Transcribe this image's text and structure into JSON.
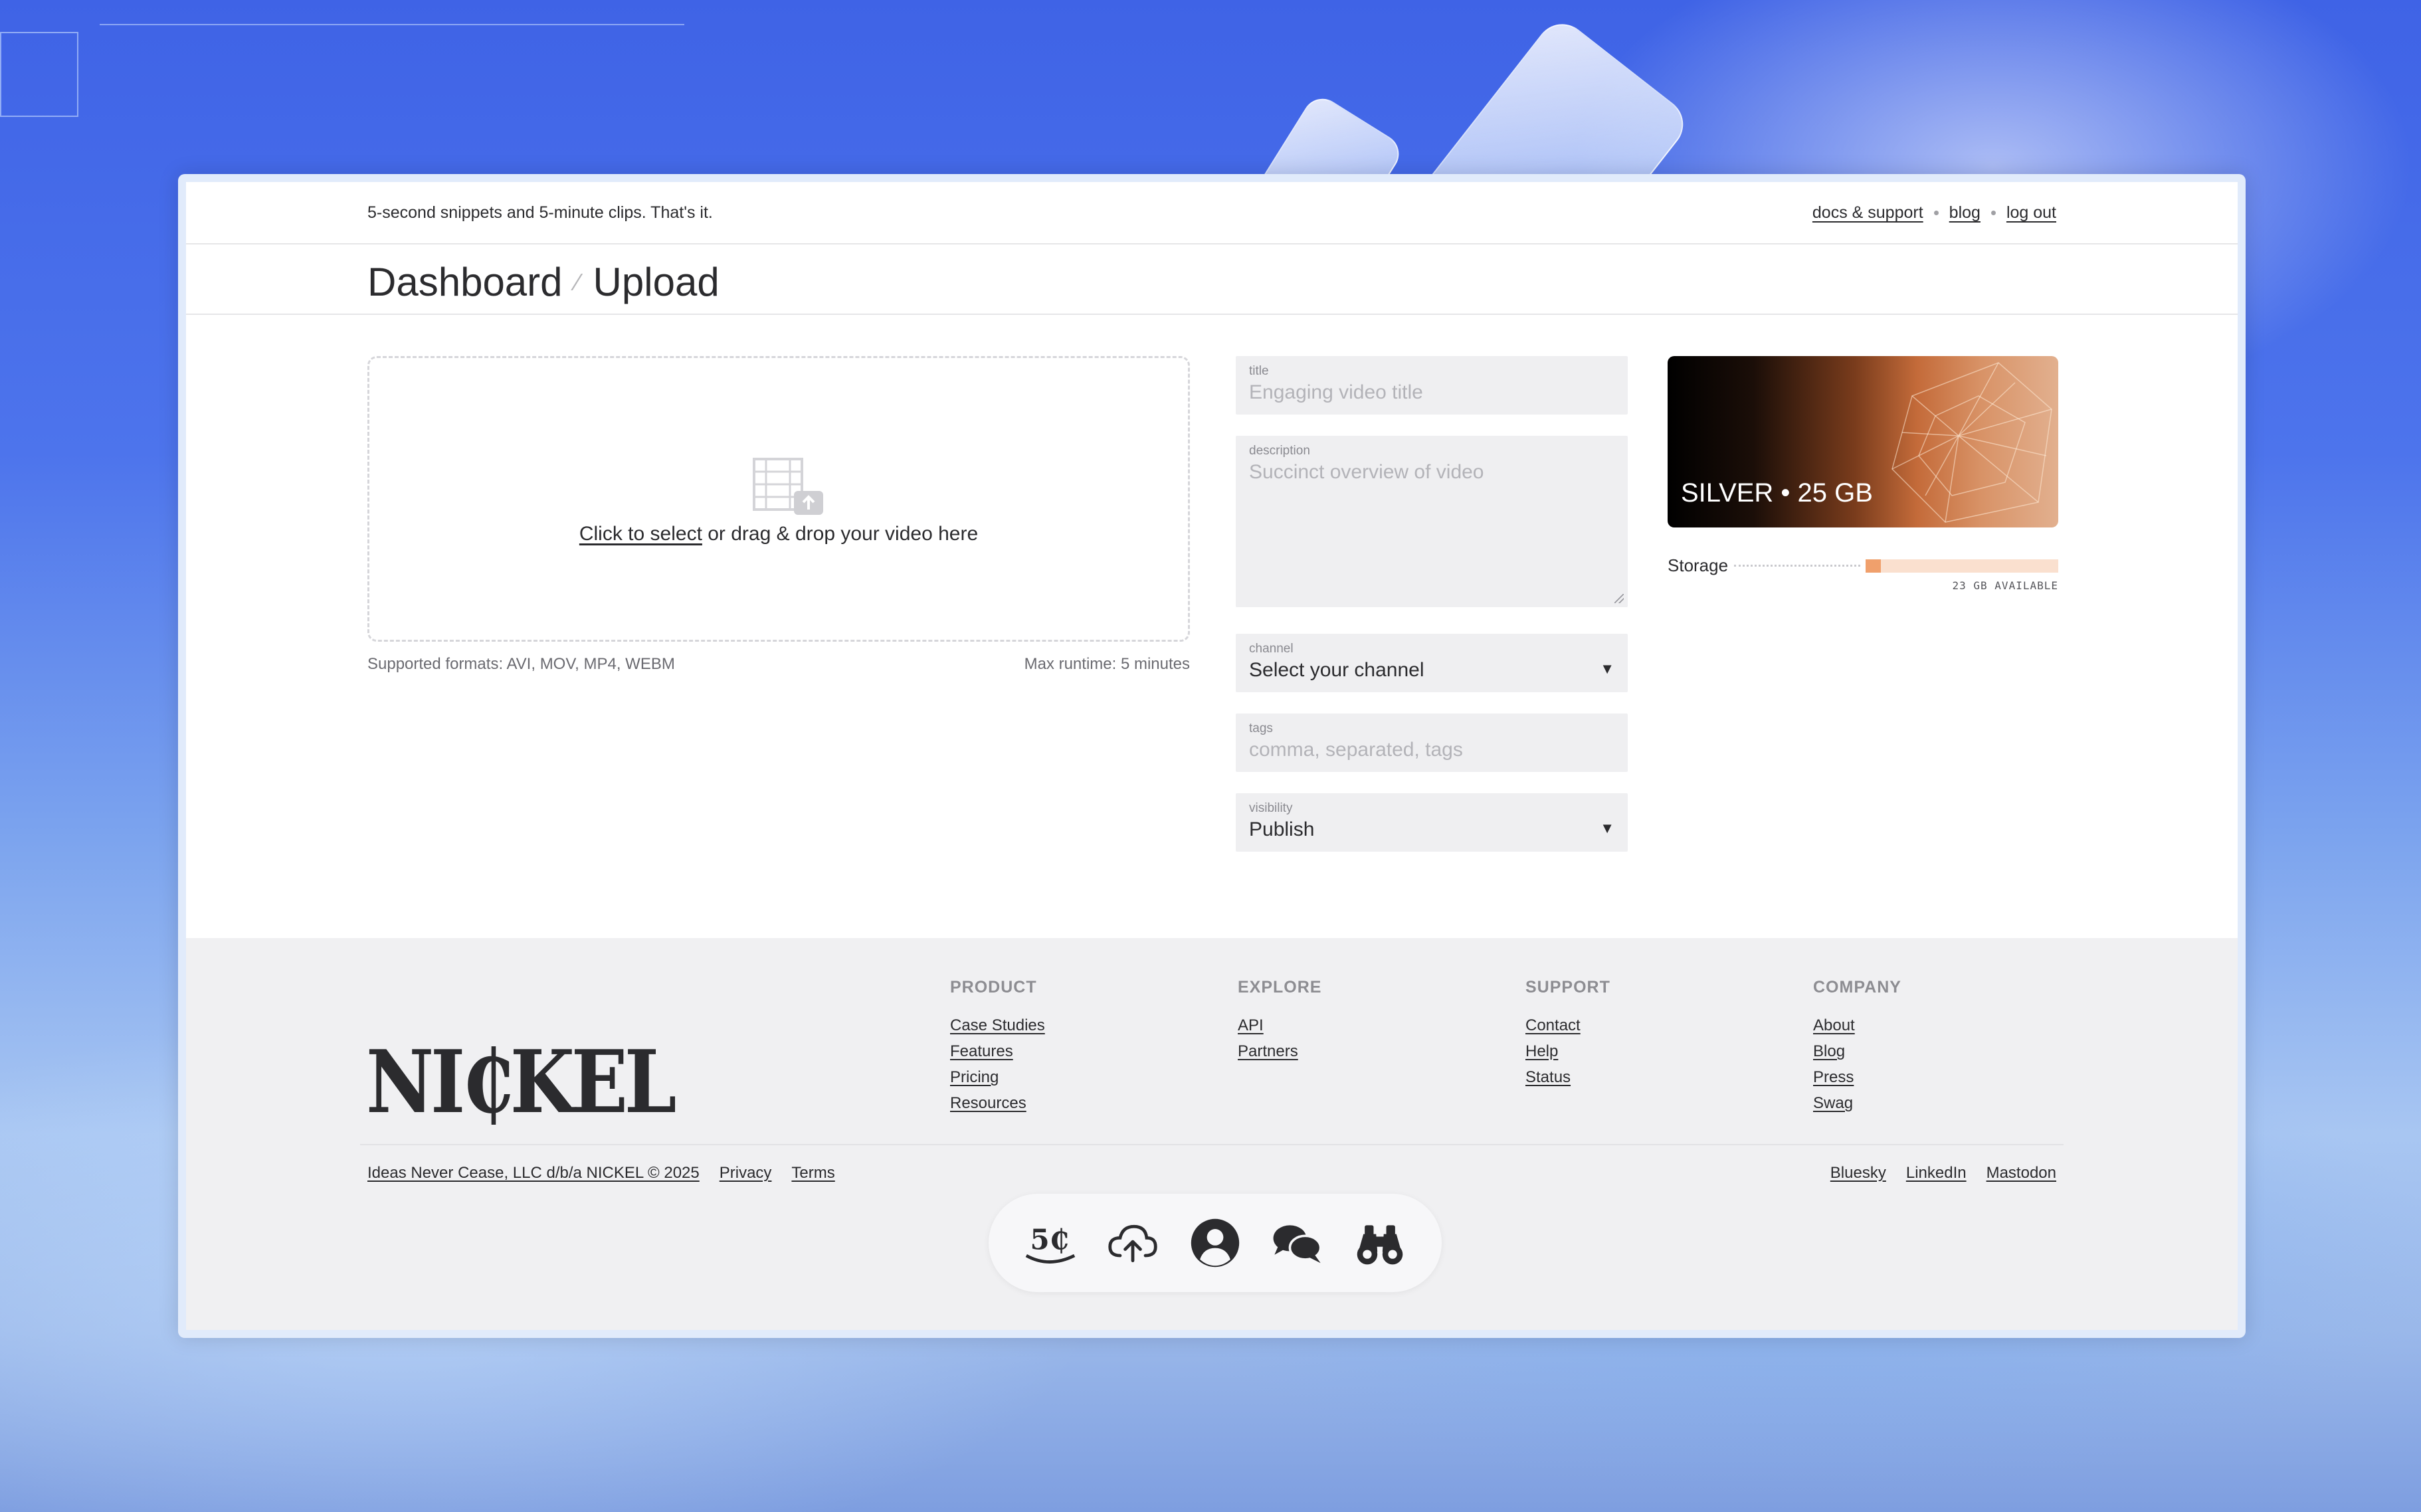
{
  "topbar": {
    "tagline": "5-second snippets and 5-minute clips. That's it.",
    "links": {
      "docs": "docs & support",
      "blog": "blog",
      "logout": "log out"
    }
  },
  "breadcrumb": {
    "dashboard": "Dashboard",
    "separator": "⁄",
    "current": "Upload"
  },
  "dropzone": {
    "select_link": "Click to select",
    "text": " or drag & drop your video here",
    "formats": "Supported formats: AVI, MOV, MP4, WEBM",
    "runtime": "Max runtime: 5 minutes"
  },
  "form": {
    "title": {
      "label": "title",
      "placeholder": "Engaging video title"
    },
    "description": {
      "label": "description",
      "placeholder": "Succinct overview of video"
    },
    "channel": {
      "label": "channel",
      "value": "Select your channel"
    },
    "tags": {
      "label": "tags",
      "placeholder": "comma, separated, tags"
    },
    "visibility": {
      "label": "visibility",
      "value": "Publish"
    }
  },
  "plan": {
    "label": "SILVER • 25 GB",
    "storage_label": "Storage",
    "available": "23 GB AVAILABLE",
    "used_fraction": 0.08,
    "color": "#f0a06c"
  },
  "footer": {
    "logo": "NI₵KEL",
    "columns": [
      {
        "heading": "PRODUCT",
        "links": [
          "Case Studies",
          "Features",
          "Pricing",
          "Resources"
        ]
      },
      {
        "heading": "EXPLORE",
        "links": [
          "API",
          "Partners"
        ]
      },
      {
        "heading": "SUPPORT",
        "links": [
          "Contact",
          "Help",
          "Status"
        ]
      },
      {
        "heading": "COMPANY",
        "links": [
          "About",
          "Blog",
          "Press",
          "Swag"
        ]
      }
    ],
    "copyright": "Ideas Never Cease, LLC d/b/a NICKEL © 2025",
    "privacy": "Privacy",
    "terms": "Terms",
    "social": [
      "Bluesky",
      "LinkedIn",
      "Mastodon"
    ]
  },
  "dock": {
    "icons": [
      "nickel-coin-icon",
      "cloud-upload-icon",
      "user-profile-icon",
      "chat-bubbles-icon",
      "binoculars-icon"
    ],
    "coin_text": "5₵"
  }
}
